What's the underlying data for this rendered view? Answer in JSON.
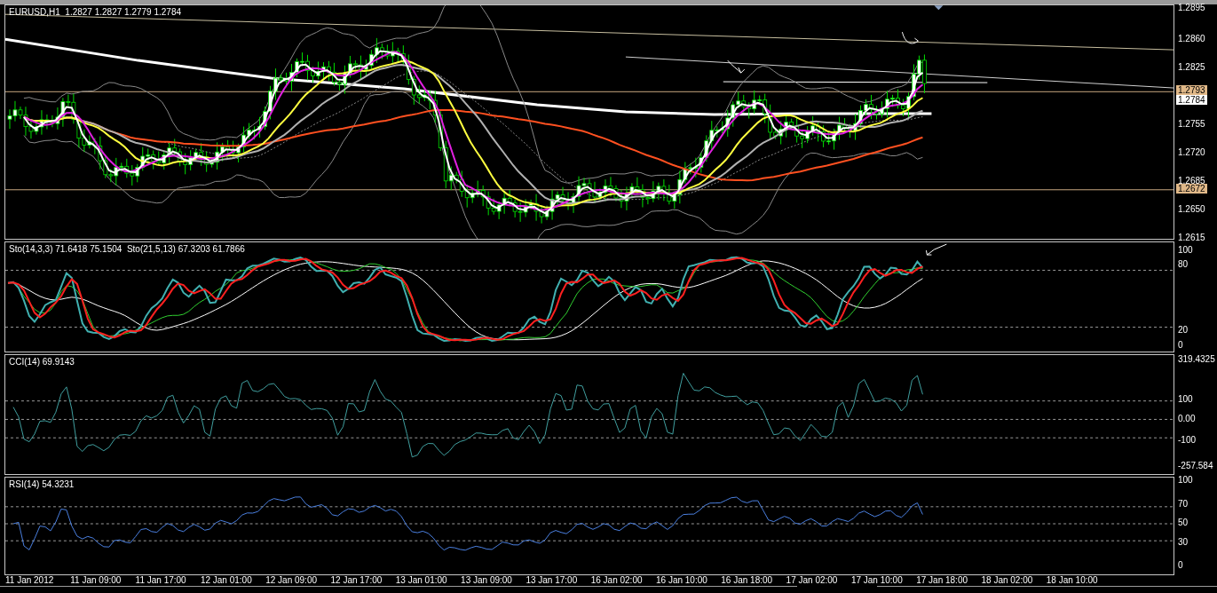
{
  "main_panel": {
    "legend": "EURUSD,H1  1.2827 1.2827 1.2779 1.2784",
    "price_axis": [
      "1.2895",
      "1.2860",
      "1.2825",
      "1.2755",
      "1.2720",
      "1.2685",
      "1.2650",
      "1.2615"
    ],
    "price_tags": [
      {
        "text": "1.2793",
        "kind": "line"
      },
      {
        "text": "1.2784",
        "kind": "bid"
      },
      {
        "text": "1.2672",
        "kind": "line"
      }
    ]
  },
  "stochastic_panel": {
    "legend": "Sto(14,3,3) 71.6418 75.1504  Sto(21,5,13) 67.3203 61.7866",
    "axis": [
      "100",
      "80",
      "20",
      "0"
    ]
  },
  "cci_panel": {
    "legend": "CCI(14) 69.9143",
    "axis": [
      "319.4325",
      "100",
      "0.00",
      "-100",
      "-257.584"
    ]
  },
  "rsi_panel": {
    "legend": "RSI(14) 54.3231",
    "axis": [
      "100",
      "70",
      "50",
      "30",
      "0"
    ]
  },
  "time_axis": [
    "11 Jan 2012",
    "11 Jan 09:00",
    "11 Jan 17:00",
    "12 Jan 01:00",
    "12 Jan 09:00",
    "12 Jan 17:00",
    "13 Jan 01:00",
    "13 Jan 09:00",
    "13 Jan 17:00",
    "16 Jan 02:00",
    "16 Jan 10:00",
    "16 Jan 18:00",
    "17 Jan 02:00",
    "17 Jan 10:00",
    "17 Jan 18:00",
    "18 Jan 02:00",
    "18 Jan 10:00"
  ]
}
